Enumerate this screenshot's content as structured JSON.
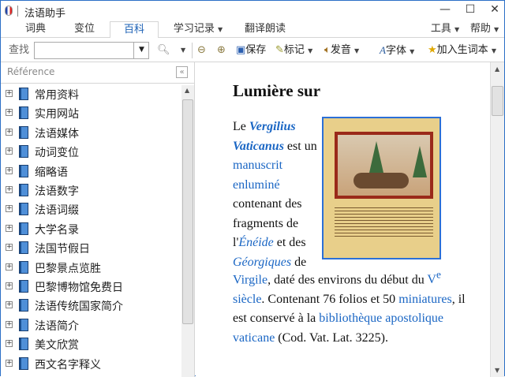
{
  "window": {
    "title": "法语助手",
    "minimize": "—",
    "maximize": "☐",
    "close": "✕"
  },
  "tabs": [
    {
      "label": "词典"
    },
    {
      "label": "变位"
    },
    {
      "label": "百科"
    },
    {
      "label": "学习记录"
    },
    {
      "label": "翻译朗读"
    }
  ],
  "menus": {
    "tools": "工具",
    "help": "帮助"
  },
  "toolbar": {
    "search_label": "查找",
    "search_value": "",
    "save": "保存",
    "mark": "标记",
    "pronounce": "发音",
    "font": "字体",
    "add_word": "加入生词本"
  },
  "sidebar": {
    "title": "Référence",
    "items": [
      {
        "label": "常用资料"
      },
      {
        "label": "实用网站"
      },
      {
        "label": "法语媒体"
      },
      {
        "label": "动词变位"
      },
      {
        "label": "缩略语"
      },
      {
        "label": "法语数字"
      },
      {
        "label": "法语词缀"
      },
      {
        "label": "大学名录"
      },
      {
        "label": "法国节假日"
      },
      {
        "label": "巴黎景点览胜"
      },
      {
        "label": "巴黎博物馆免费日"
      },
      {
        "label": "法语传统国家简介"
      },
      {
        "label": "法语简介"
      },
      {
        "label": "美文欣赏"
      },
      {
        "label": "西文名字释义"
      }
    ]
  },
  "article": {
    "heading": "Lumière sur",
    "t1": "Le ",
    "l1": "Vergilius Vaticanus",
    "t2": " est un ",
    "l2": "manuscrit enluminé",
    "t3": " contenant des fragments de l'",
    "l3": "Énéide",
    "t4": " et des ",
    "l4": "Géorgiques",
    "t5": " de ",
    "l5": "Virgile",
    "t6": ", daté des environs du début du ",
    "l6a": "V",
    "l6sup": "e",
    "l6b": " siècle",
    "t7": ". Contenant 76 folios et 50 ",
    "l7": "miniatures",
    "t8": ", il est conservé à la ",
    "l8": "bibliothèque apostolique vaticane",
    "t9": " (Cod. Vat. Lat. 3225)."
  }
}
